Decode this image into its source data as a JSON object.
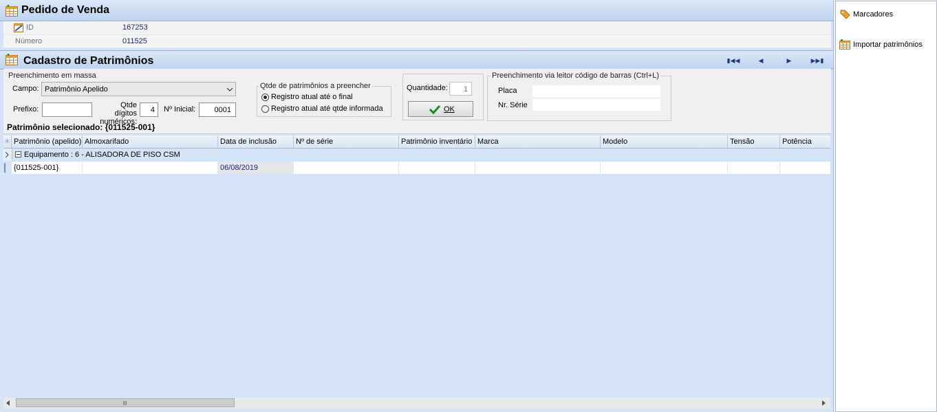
{
  "pedido": {
    "title": "Pedido de Venda",
    "fields": [
      {
        "label": "ID",
        "value": "167253"
      },
      {
        "label": "Número",
        "value": "011525"
      }
    ]
  },
  "cadastro": {
    "title": "Cadastro de Patrimônios",
    "nav": [
      "first-icon",
      "prev-icon",
      "next-icon",
      "last-icon"
    ]
  },
  "massa": {
    "title": "Preenchimento em massa",
    "campo_label": "Campo:",
    "campo_value": "Patrimônio Apelido",
    "prefixo_label": "Prefixo:",
    "prefixo_value": "",
    "qtde_digitos_label_1": "Qtde dígitos",
    "qtde_digitos_label_2": "numéricos:",
    "qtde_digitos_value": "4",
    "inicial_label": "Nº Inicial:",
    "inicial_value": "0001"
  },
  "qtde": {
    "title": "Qtde de patrimônios a preencher",
    "option1": "Registro atual até o final",
    "option2": "Registro atual até qtde informada",
    "selected": 1,
    "quantidade_label": "Quantidade:",
    "quantidade_value": "1",
    "ok_label": "OK"
  },
  "barras": {
    "title": "Preenchimento via leitor código de barras (Ctrl+L)",
    "placa_label": "Placa",
    "placa_value": "",
    "serie_label": "Nr. Série",
    "serie_value": ""
  },
  "selecionado": "Patrimônio selecionado: {011525-001}",
  "grid": {
    "columns": [
      "Patrimônio (apelido)",
      "Almoxarifado",
      "Data de inclusão",
      "Nº de série",
      "Patrimônio inventário",
      "Marca",
      "Modelo",
      "Tensão",
      "Potência"
    ],
    "group_label": "Equipamento : 6 - ALISADORA DE PISO CSM",
    "rows": [
      [
        "{011525-001}",
        "",
        "06/08/2019",
        "",
        "",
        "",
        "",
        "",
        ""
      ]
    ]
  },
  "side": {
    "items": [
      {
        "icon": "tag-icon",
        "label": "Marcadores"
      },
      {
        "icon": "table-icon",
        "label": "Importar patrimônios"
      }
    ]
  },
  "colors": {
    "header_bg": "#bcd3f0",
    "value_text": "#1e2a6e",
    "grid_bg": "#d4e3f6"
  }
}
